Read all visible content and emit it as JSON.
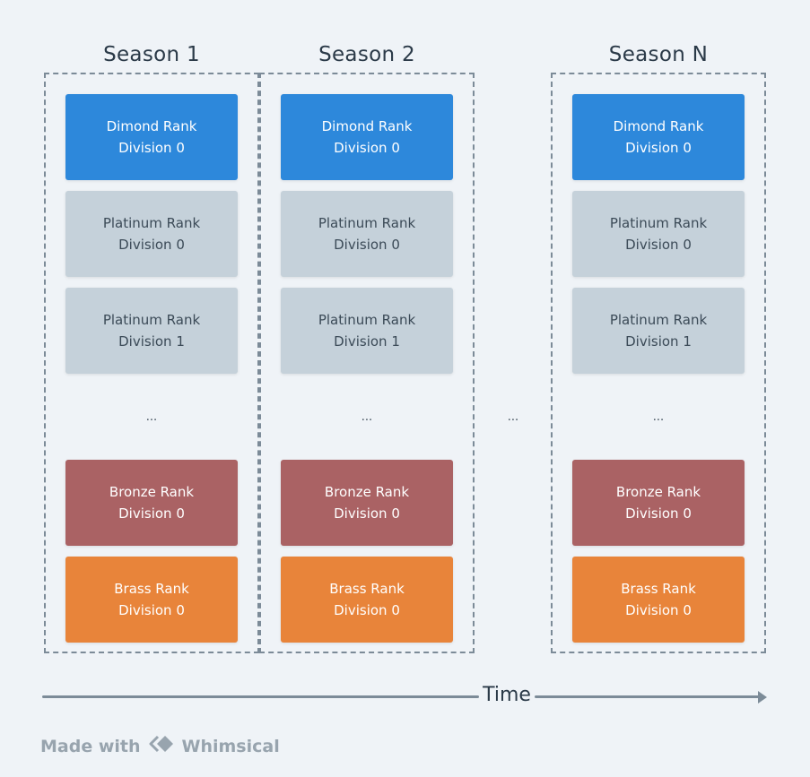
{
  "seasons": [
    {
      "title": "Season 1",
      "cards": [
        {
          "rank": "Dimond Rank",
          "division": "Division 0",
          "tier": "diamond"
        },
        {
          "rank": "Platinum Rank",
          "division": "Division 0",
          "tier": "platinum"
        },
        {
          "rank": "Platinum Rank",
          "division": "Division 1",
          "tier": "platinum"
        },
        {
          "rank": "Bronze Rank",
          "division": "Division 0",
          "tier": "bronze"
        },
        {
          "rank": "Brass Rank",
          "division": "Division 0",
          "tier": "brass"
        }
      ],
      "ellipsis": "..."
    },
    {
      "title": "Season 2",
      "cards": [
        {
          "rank": "Dimond Rank",
          "division": "Division 0",
          "tier": "diamond"
        },
        {
          "rank": "Platinum Rank",
          "division": "Division 0",
          "tier": "platinum"
        },
        {
          "rank": "Platinum Rank",
          "division": "Division 1",
          "tier": "platinum"
        },
        {
          "rank": "Bronze Rank",
          "division": "Division 0",
          "tier": "bronze"
        },
        {
          "rank": "Brass Rank",
          "division": "Division 0",
          "tier": "brass"
        }
      ],
      "ellipsis": "..."
    },
    {
      "title": "Season N",
      "cards": [
        {
          "rank": "Dimond Rank",
          "division": "Division 0",
          "tier": "diamond"
        },
        {
          "rank": "Platinum Rank",
          "division": "Division 0",
          "tier": "platinum"
        },
        {
          "rank": "Platinum Rank",
          "division": "Division 1",
          "tier": "platinum"
        },
        {
          "rank": "Bronze Rank",
          "division": "Division 0",
          "tier": "bronze"
        },
        {
          "rank": "Brass Rank",
          "division": "Division 0",
          "tier": "brass"
        }
      ],
      "ellipsis": "..."
    }
  ],
  "between_seasons_ellipsis": "...",
  "timeline": {
    "label": "Time"
  },
  "footer": {
    "made_with": "Made with",
    "brand": "Whimsical"
  },
  "colors": {
    "diamond": "#2d88db",
    "platinum": "#c5d1da",
    "bronze": "#aa6264",
    "brass": "#e8843a",
    "background": "#eff3f7"
  }
}
